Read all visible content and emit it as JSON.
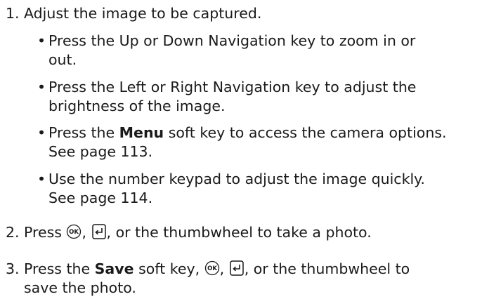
{
  "steps": [
    {
      "number": "1.",
      "text": "Adjust the image to be captured."
    },
    {
      "number": "2.",
      "prefix": "Press",
      "suffix": ", or the thumbwheel to take a photo.",
      "icons": [
        "ok-key-icon",
        "enter-key-icon"
      ]
    },
    {
      "number": "3.",
      "prefix": "Press the",
      "bold": "Save",
      "middle": "soft key,",
      "suffix": ", or the thumbwheel to",
      "line2": "save the photo.",
      "icons": [
        "ok-key-icon",
        "enter-key-icon"
      ]
    }
  ],
  "bullets": [
    {
      "line1": "Press the Up or Down Navigation key to zoom in or",
      "line2": "out."
    },
    {
      "line1": "Press the Left or Right Navigation key to adjust the",
      "line2": "brightness of the image."
    },
    {
      "prefix": "Press the",
      "bold": "Menu",
      "line1_rest": "soft key to access the camera options.",
      "line2": "See page 113."
    },
    {
      "line1": "Use the number keypad to adjust the image quickly.",
      "line2": "See page 114."
    }
  ],
  "icons": {
    "ok_label": "OK"
  },
  "punct": {
    "comma": ","
  },
  "bullet_char": "•"
}
